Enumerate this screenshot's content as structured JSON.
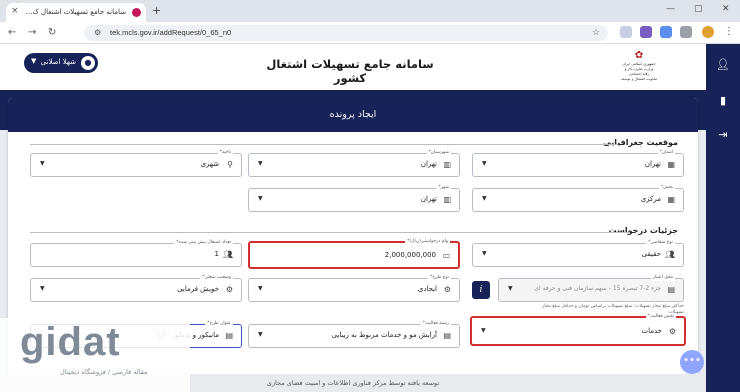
{
  "browser": {
    "tab_title": "سامانه جامع تسهیلات اشتغال ک...",
    "url": "tek.mcls.gov.ir/addRequest/0_65_n0"
  },
  "header": {
    "site_title": "سامانه جامع تسهیلات اشتغال کشور",
    "user_label": "شهلا اصلانی",
    "emblem_lines": [
      "جمهوری اسلامی ایران",
      "وزارت تعاون، کار و",
      "رفاه اجتماعی",
      "معاونت اشتغال و توسعه"
    ]
  },
  "panel": {
    "title": "ایجاد پرونده",
    "section_geo": "موقعیت جغرافیایی",
    "section_req": "جزئیات درخواست"
  },
  "fields": {
    "province": {
      "label": "استان*",
      "value": "تهران"
    },
    "county": {
      "label": "شهرستان*",
      "value": "تهران"
    },
    "location": {
      "label": "ناحیه*",
      "value": "شهری"
    },
    "district": {
      "label": "بخش*",
      "value": "مرکزی"
    },
    "city": {
      "label": "شهر*",
      "value": "تهران"
    },
    "applicant_type": {
      "label": "نوع متقاضی*",
      "value": "حقیقی"
    },
    "loan_amount": {
      "label": "وام درخواستی(ریال)*",
      "value": "2,000,000,000"
    },
    "jobs_count": {
      "label": "تعداد اشتغال پیش بینی شده*",
      "value": "1"
    },
    "plan_type": {
      "label": "نوع طرح*",
      "value": "ایجادی"
    },
    "legal_status": {
      "label": "وضعیت شغلی*",
      "value": "خویش فرمایی"
    },
    "resource": {
      "label": "محل اعتبار",
      "value": "جزء 2-7 تبصره 15 - سهم سازمان فنی و حرفه ای"
    },
    "activity_sector": {
      "label": "بخش فعالیت*",
      "value": "خدمات"
    },
    "activity_field": {
      "label": "رسته فعالیت*",
      "value": "آرایش مو و خدمات مربوط به زیبایی"
    },
    "plan_title": {
      "label": "عنوان طرح*",
      "value": "مانیکور و پدیکور - آرا"
    }
  },
  "help_text": {
    "line1": "حداکثر مبلغ مجاز تسهیلات: مبلغ تسهیلات براساس تومان و حداقل مبلغ مجاز",
    "line2": "تسهیلات"
  },
  "footer": {
    "text": "توسعه یافته توسط مرکز فناوری اطلاعات و امنیت فضای مجازی"
  },
  "watermark": {
    "logo": "gidat",
    "tagline": "مقاله فارسی / فروشگاه دیجیتال"
  },
  "fab": {
    "label": "•••"
  },
  "colors": {
    "navy": "#172358",
    "highlight": "#d32f2f",
    "fab": "#8fa5ff"
  }
}
